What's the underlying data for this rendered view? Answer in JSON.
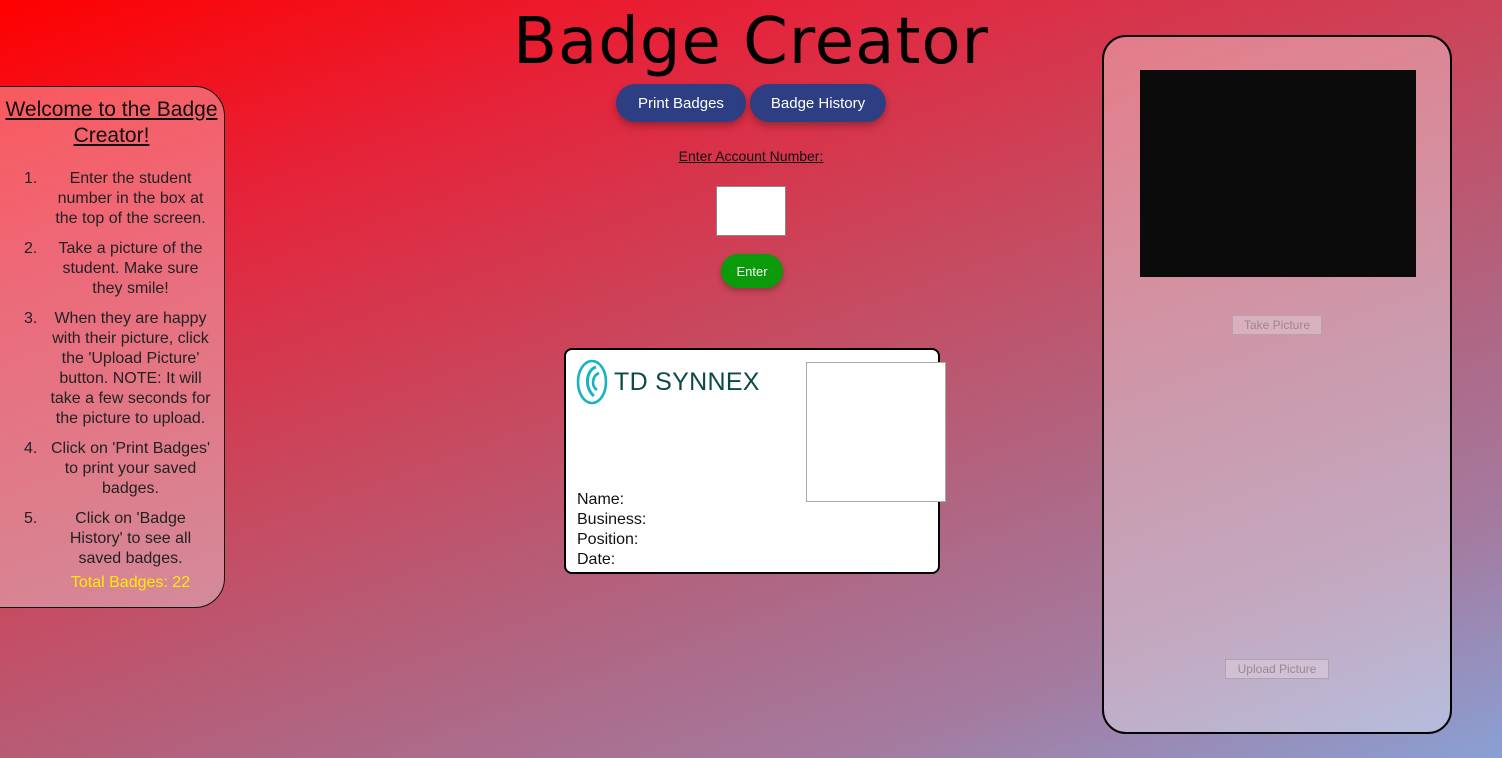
{
  "app": {
    "title": "Badge Creator"
  },
  "nav": {
    "print_label": "Print Badges",
    "history_label": "Badge History"
  },
  "account": {
    "label": "Enter Account Number:",
    "value": "",
    "enter_label": "Enter"
  },
  "welcome": {
    "heading": "Welcome to the Badge Creator!",
    "steps": [
      {
        "num": "1.",
        "text": "Enter the student number in the box at the top of the screen."
      },
      {
        "num": "2.",
        "text": "Take a picture of the student. Make sure they smile!"
      },
      {
        "num": "3.",
        "text": "When they are happy with their picture, click the 'Upload Picture' button. NOTE: It will take a few seconds for the picture to upload."
      },
      {
        "num": "4.",
        "text": "Click on 'Print Badges' to print your saved badges."
      },
      {
        "num": "5.",
        "text": "Click on 'Badge History' to see all saved badges."
      }
    ],
    "total": "Total Badges: 22"
  },
  "badge": {
    "logo_text": "TD SYNNEX",
    "logo_icon": "td-synnex-swirl-icon",
    "name_label": "Name:",
    "business_label": "Business:",
    "position_label": "Position:",
    "date_label": "Date:"
  },
  "camera": {
    "take_label": "Take Picture",
    "upload_label": "Upload Picture"
  },
  "colors": {
    "nav_button": "#2d3e82",
    "enter_button": "#0a9a0a",
    "total_text": "#ffea00",
    "logo_teal": "#16b3c4",
    "logo_text": "#0a4a48"
  }
}
